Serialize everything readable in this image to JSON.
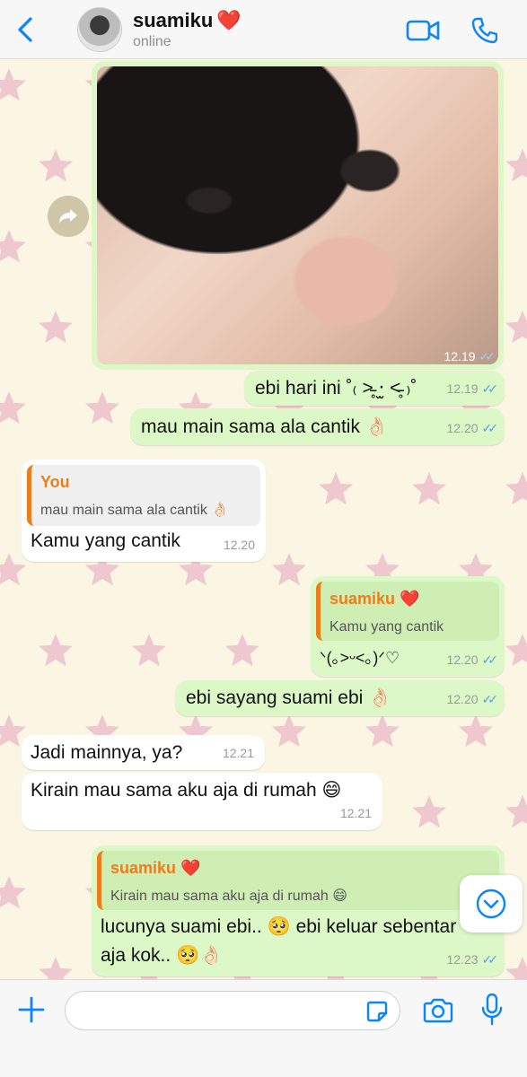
{
  "header": {
    "contact_name": "suamiku",
    "contact_emoji": "❤️",
    "status": "online",
    "icons": [
      "chevron-left-icon",
      "avatar",
      "video-camera-icon",
      "phone-icon"
    ],
    "accent_color": "#0a84ff"
  },
  "messages": [
    {
      "id": "m1",
      "type": "image",
      "direction": "out",
      "time": "12.19",
      "read": true
    },
    {
      "id": "m2",
      "direction": "out",
      "text": "ebi hari ini ˚₍ ˃̵̵̥ ‧̫ ˂̵̵̥ ₎˚",
      "time": "12.19",
      "read": true
    },
    {
      "id": "m3",
      "direction": "out",
      "text": "mau main sama ala cantik 👌🏻",
      "time": "12.20",
      "read": true
    },
    {
      "id": "m4",
      "direction": "in",
      "quote": {
        "name": "You",
        "text": "mau main sama ala cantik 👌🏻"
      },
      "text": "Kamu yang cantik",
      "time": "12.20"
    },
    {
      "id": "m5",
      "direction": "out",
      "quote": {
        "name": "suamiku ❤️",
        "text": "Kamu yang cantik"
      },
      "text": "ᐠ(｡˃ᵕ˂｡)ᐟ♡",
      "time": "12.20",
      "read": true
    },
    {
      "id": "m6",
      "direction": "out",
      "text": "ebi sayang suami ebi 👌🏻",
      "time": "12.20",
      "read": true
    },
    {
      "id": "m7",
      "direction": "in",
      "text": "Jadi mainnya, ya?",
      "time": "12.21"
    },
    {
      "id": "m8",
      "direction": "in",
      "text": "Kirain mau sama aku aja di rumah 😄",
      "time": "12.21"
    },
    {
      "id": "m9",
      "direction": "out",
      "quote": {
        "name": "suamiku ❤️",
        "text": "Kirain mau sama aku aja di rumah 😄"
      },
      "text_line1": "lucunya suami ebi.. 🥺 ebi keluar sebentar",
      "text_line2": "aja kok.. 🥺👌🏻",
      "time": "12.23",
      "read": true
    }
  ],
  "colors": {
    "outgoing_bubble": "#dcf8c6",
    "incoming_bubble": "#ffffff",
    "quote_accent": "#ef7c1a",
    "read_ticks": "#4fa3e8",
    "wallpaper": "#fbf6e4",
    "wallpaper_stars": "#efc8cf"
  },
  "composer": {
    "placeholder": "",
    "icons": [
      "plus-icon",
      "sticker-icon",
      "camera-icon",
      "microphone-icon"
    ]
  },
  "floating": {
    "forward_icon": "forward-icon",
    "scroll_down_icon": "chevron-down-icon"
  },
  "read_mark": "✓✓"
}
